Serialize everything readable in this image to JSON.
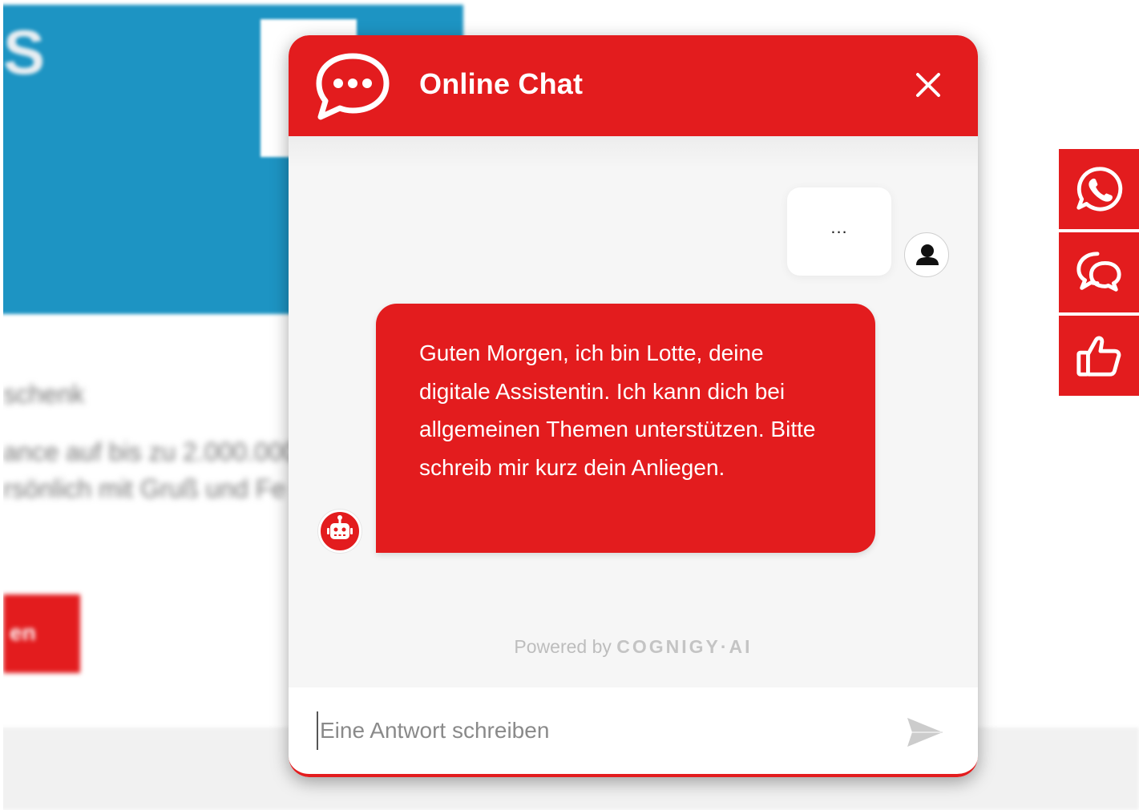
{
  "background": {
    "letter": "S",
    "lines": [
      "schenk",
      "ance auf bis zu 2.000.000",
      "rsönlich mit Gruß und Fe"
    ],
    "button_label": "en"
  },
  "side_bar": {
    "items": [
      {
        "icon": "whatsapp-icon"
      },
      {
        "icon": "chat-bubbles-icon"
      },
      {
        "icon": "thumbs-up-icon"
      }
    ]
  },
  "chat": {
    "title": "Online Chat",
    "user_message": "...",
    "bot_message": "Guten Morgen, ich bin Lotte, deine digitale Assistentin. Ich kann dich bei allgemeinen Themen unterstützen. Bitte schreib mir kurz dein Anliegen.",
    "powered_prefix": "Powered by",
    "powered_brand": "COGNIGY·AI",
    "input_placeholder": "Eine Antwort schreiben",
    "input_value": ""
  },
  "colors": {
    "accent": "#e31c1e",
    "background_blue": "#1d94c3",
    "chat_body": "#f6f6f6"
  }
}
